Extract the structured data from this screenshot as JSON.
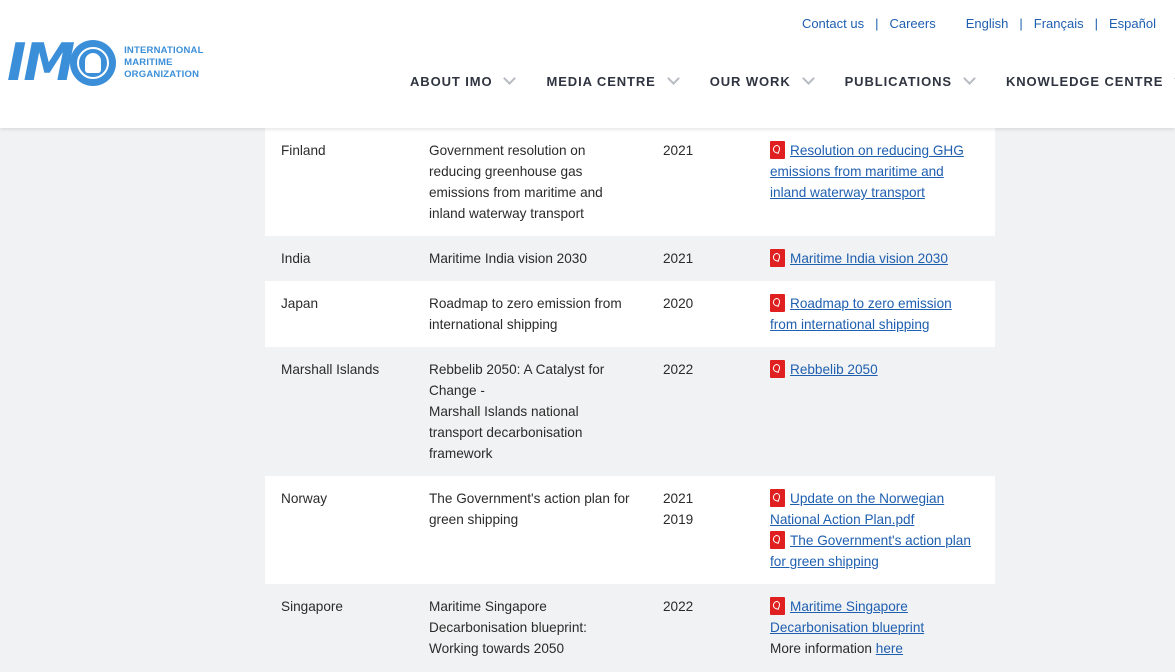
{
  "utility_nav": {
    "contact": "Contact us",
    "careers": "Careers",
    "separator": "|",
    "languages": [
      "English",
      "Français",
      "Español"
    ]
  },
  "logo": {
    "letters": "IM",
    "text_lines": [
      "INTERNATIONAL",
      "MARITIME",
      "ORGANIZATION"
    ],
    "brand_color": "#3b8fd8"
  },
  "main_nav": [
    "ABOUT IMO",
    "MEDIA CENTRE",
    "OUR WORK",
    "PUBLICATIONS",
    "KNOWLEDGE CENTRE"
  ],
  "table": {
    "rows": [
      {
        "country": "Finland",
        "title_lines": [
          "Government resolution on reducing greenhouse gas emissions from maritime and inland waterway transport"
        ],
        "years": [
          "2021"
        ],
        "documents": [
          "Resolution on reducing GHG emissions from maritime and inland waterway transport"
        ]
      },
      {
        "country": "India",
        "title_lines": [
          "Maritime India vision 2030"
        ],
        "years": [
          "2021"
        ],
        "documents": [
          "Maritime India vision 2030"
        ]
      },
      {
        "country": "Japan",
        "title_lines": [
          "Roadmap to zero emission from international shipping"
        ],
        "years": [
          "2020"
        ],
        "documents": [
          "Roadmap to zero emission from international shipping"
        ]
      },
      {
        "country": "Marshall Islands",
        "title_lines": [
          "Rebbelib 2050: A Catalyst for Change -",
          "Marshall Islands national transport decarbonisation framework"
        ],
        "years": [
          "2022"
        ],
        "documents": [
          "Rebbelib 2050"
        ]
      },
      {
        "country": "Norway",
        "title_lines": [
          "The Government's action plan for green shipping"
        ],
        "years": [
          "2021",
          "2019"
        ],
        "documents": [
          "Update on the Norwegian National Action Plan.pdf",
          "The Government's action plan for green shipping"
        ]
      },
      {
        "country": "Singapore",
        "title_lines": [
          "Maritime Singapore Decarbonisation blueprint: Working towards 2050"
        ],
        "years": [
          "2022"
        ],
        "documents": [
          "Maritime Singapore Decarbonisation blueprint"
        ],
        "more_info_text": "More information",
        "more_info_link": "here"
      }
    ]
  },
  "colors": {
    "link": "#1f5fb0",
    "pdf_icon": "#e02020",
    "row_alt": "#f1f2f3"
  }
}
